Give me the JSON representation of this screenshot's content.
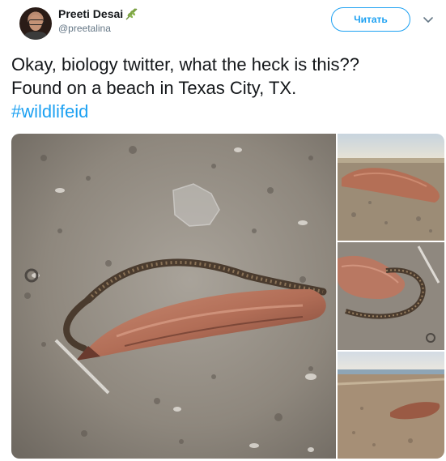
{
  "tweet": {
    "author": {
      "display_name": "Preeti Desai",
      "handle": "@preetalina",
      "badge_icon": "leaf-icon"
    },
    "follow_button_label": "Читать",
    "menu_icon": "chevron-down-icon",
    "text_lines": [
      "Okay, biology twitter, what the heck is this??",
      "Found on a beach in Texas City, TX."
    ],
    "hashtag": "#wildlifeid"
  },
  "colors": {
    "accent": "#1da1f2",
    "text": "#14171a",
    "muted": "#657786"
  }
}
